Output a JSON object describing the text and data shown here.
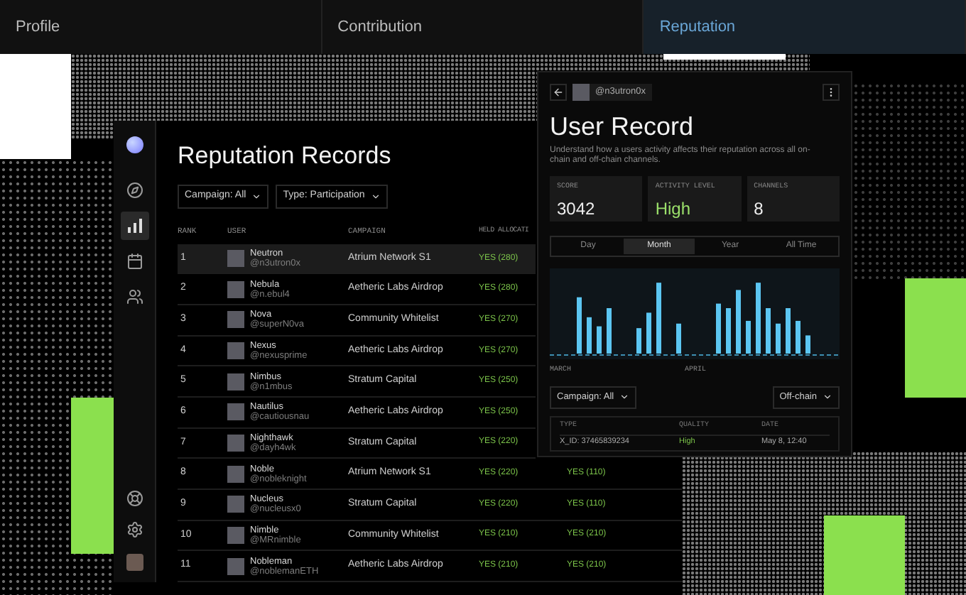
{
  "tabs": [
    {
      "label": "Profile",
      "selected": false
    },
    {
      "label": "Contribution",
      "selected": false
    },
    {
      "label": "Reputation",
      "selected": true
    }
  ],
  "sidebar": {
    "items": [
      {
        "kind": "compass",
        "selected": false
      },
      {
        "kind": "chart",
        "selected": true
      },
      {
        "kind": "calendar",
        "selected": false
      },
      {
        "kind": "users",
        "selected": false
      }
    ],
    "bottom_items": [
      {
        "kind": "help"
      },
      {
        "kind": "settings"
      }
    ]
  },
  "records": {
    "title": "Reputation Records",
    "filters": [
      "Campaign: All",
      "Type: Participation"
    ],
    "columns": [
      "RANK",
      "USER",
      "CAMPAIGN",
      "HELD ALLOCATI"
    ],
    "rows": [
      {
        "rank": "1",
        "name": "Neutron",
        "handle": "@n3utron0x",
        "campaign": "Atrium Network S1",
        "held": "YES (280)",
        "selected": true
      },
      {
        "rank": "2",
        "name": "Nebula",
        "handle": "@n.ebul4",
        "campaign": "Aetheric Labs Airdrop",
        "held": "YES (280)",
        "selected": false
      },
      {
        "rank": "3",
        "name": "Nova",
        "handle": "@superN0va",
        "campaign": "Community Whitelist",
        "held": "YES (270)",
        "selected": false
      },
      {
        "rank": "4",
        "name": "Nexus",
        "handle": "@nexusprime",
        "campaign": "Aetheric Labs Airdrop",
        "held": "YES (270)",
        "selected": false
      },
      {
        "rank": "5",
        "name": "Nimbus",
        "handle": "@n1mbus",
        "campaign": "Stratum Capital",
        "held": "YES (250)",
        "selected": false
      },
      {
        "rank": "6",
        "name": "Nautilus",
        "handle": "@cautiousnau",
        "campaign": "Aetheric Labs Airdrop",
        "held": "YES (250)",
        "selected": false
      },
      {
        "rank": "7",
        "name": "Nighthawk",
        "handle": "@dayh4wk",
        "campaign": "Stratum Capital",
        "held": "YES (220)",
        "selected": false
      },
      {
        "rank": "8",
        "name": "Noble",
        "handle": "@nobleknight",
        "campaign": "Atrium Network S1",
        "held": "YES (220)",
        "column_5": "YES (110)",
        "selected": false
      },
      {
        "rank": "9",
        "name": "Nucleus",
        "handle": "@nucleusx0",
        "campaign": "Stratum Capital",
        "held": "YES (220)",
        "column_5": "YES (110)",
        "selected": false
      },
      {
        "rank": "10",
        "name": "Nimble",
        "handle": "@MRnimble",
        "campaign": "Community Whitelist",
        "held": "YES (210)",
        "column_5": "YES (210)",
        "selected": false
      },
      {
        "rank": "11",
        "name": "Nobleman",
        "handle": "@noblemanETH",
        "campaign": "Aetheric Labs Airdrop",
        "held": "YES (210)",
        "column_5": "YES (210)",
        "selected": false
      }
    ]
  },
  "user_record": {
    "handle": "@n3utron0x",
    "title": "User Record",
    "description": "Understand how a users activity affects their reputation across all on-chain and off-chain channels.",
    "stats": [
      {
        "label": "SCORE",
        "value": "3042",
        "highlight": false
      },
      {
        "label": "ACTIVITY LEVEL",
        "value": "High",
        "highlight": true
      },
      {
        "label": "CHANNELS",
        "value": "8",
        "highlight": false
      }
    ],
    "periods": [
      {
        "label": "Day",
        "selected": false
      },
      {
        "label": "Month",
        "selected": true
      },
      {
        "label": "Year",
        "selected": false
      },
      {
        "label": "All Time",
        "selected": false
      }
    ],
    "chart_labels": [
      "MARCH",
      "APRIL"
    ],
    "filters": [
      "Campaign: All",
      "Off-chain"
    ],
    "columns": [
      "TYPE",
      "QUALITY",
      "DATE"
    ],
    "rows": [
      {
        "type": "X_ID: 37465839234",
        "quality": "High",
        "date": "May 8, 12:40"
      }
    ]
  }
}
